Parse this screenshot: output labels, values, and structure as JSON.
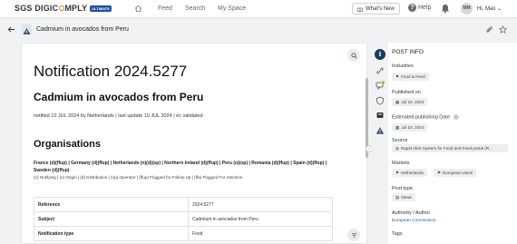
{
  "topbar": {
    "logo_prefix": "SGS DIGIC",
    "logo_suffix": "MPLY",
    "logo_badge": "ULTIMATE",
    "nav": [
      "Feed",
      "Search",
      "My Space"
    ],
    "whats_new": "What's New",
    "help": "Help",
    "avatar_initials": "MM",
    "user_greeting": "Hi, Max"
  },
  "pagebar": {
    "title": "Cadmium in avocados from Peru"
  },
  "content": {
    "notification_title": "Notification 2024.5277",
    "subtitle": "Cadmium in avocados from Peru",
    "notified_line": "notified 10 JUL 2024 by Netherlands | last update 10 JUL 2024 | ec validated",
    "organisations_heading": "Organisations",
    "organisations_list": "France (d)(ffup) | Germany (d)(ffup) | Netherlands (n)(d)(op) | Northern Ireland (d)(ffup) | Peru (o)(op) | Romania (d)(ffup) | Spain (d)(ffup) | Sweden (d)(ffup)",
    "organisations_legend": "(n) Notifying | (o) Origin | (d) Distribution | (op) Operator | (ffup) Flagged for Follow-Up | (ffa) Flagged For Attention",
    "table": [
      {
        "key": "Reference",
        "value": "2024.5277"
      },
      {
        "key": "Subject",
        "value": "Cadmium in avocados from Peru"
      },
      {
        "key": "Notification type",
        "value": "Food"
      }
    ]
  },
  "info_panel": {
    "title": "POST INFO",
    "industries_label": "Industries",
    "industries": [
      "Food & Feed"
    ],
    "published_label": "Published on",
    "published_date": "Jul 10, 2024",
    "estimated_label": "Estimated publishing Date",
    "estimated_date": "Jul 10, 2024",
    "source_label": "Source",
    "source": "Rapid Alert System for Food and Feed portal (R...",
    "markets_label": "Markets",
    "markets": [
      "Netherlands",
      "European Union"
    ],
    "post_type_label": "Post type",
    "post_type": "News",
    "authority_label": "Authority / Author",
    "authority": "European Commission",
    "tags_label": "Tags"
  },
  "colors": {
    "brand_badge": "#1f4e9c",
    "logo_accent": "#e67e22",
    "rail_active": "#1f3a5c",
    "notification_badge": "#f39c12",
    "link": "#2e5c8a"
  }
}
